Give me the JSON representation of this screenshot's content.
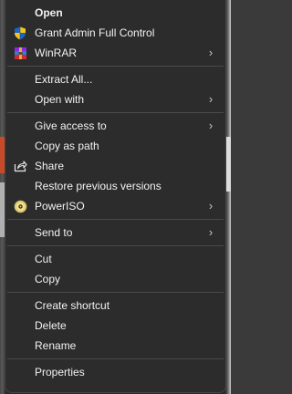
{
  "menu": {
    "groups": [
      {
        "items": [
          {
            "label": "Open",
            "bold": true,
            "icon": null,
            "submenu": false
          },
          {
            "label": "Grant Admin Full Control",
            "bold": false,
            "icon": "uac-shield-icon",
            "submenu": false
          },
          {
            "label": "WinRAR",
            "bold": false,
            "icon": "winrar-icon",
            "submenu": true
          }
        ]
      },
      {
        "items": [
          {
            "label": "Extract All...",
            "bold": false,
            "icon": null,
            "submenu": false
          },
          {
            "label": "Open with",
            "bold": false,
            "icon": null,
            "submenu": true
          }
        ]
      },
      {
        "items": [
          {
            "label": "Give access to",
            "bold": false,
            "icon": null,
            "submenu": true
          },
          {
            "label": "Copy as path",
            "bold": false,
            "icon": null,
            "submenu": false
          },
          {
            "label": "Share",
            "bold": false,
            "icon": "share-icon",
            "submenu": false
          },
          {
            "label": "Restore previous versions",
            "bold": false,
            "icon": null,
            "submenu": false
          },
          {
            "label": "PowerISO",
            "bold": false,
            "icon": "poweriso-icon",
            "submenu": true
          }
        ]
      },
      {
        "items": [
          {
            "label": "Send to",
            "bold": false,
            "icon": null,
            "submenu": true
          }
        ]
      },
      {
        "items": [
          {
            "label": "Cut",
            "bold": false,
            "icon": null,
            "submenu": false
          },
          {
            "label": "Copy",
            "bold": false,
            "icon": null,
            "submenu": false
          }
        ]
      },
      {
        "items": [
          {
            "label": "Create shortcut",
            "bold": false,
            "icon": null,
            "submenu": false
          },
          {
            "label": "Delete",
            "bold": false,
            "icon": null,
            "submenu": false
          },
          {
            "label": "Rename",
            "bold": false,
            "icon": null,
            "submenu": false
          }
        ]
      },
      {
        "items": [
          {
            "label": "Properties",
            "bold": false,
            "icon": null,
            "submenu": false
          }
        ]
      }
    ],
    "submenu_glyph": "›",
    "colors": {
      "background": "#2c2c2c",
      "text": "#f2f2f2",
      "separator": "#4a4a4a"
    }
  }
}
